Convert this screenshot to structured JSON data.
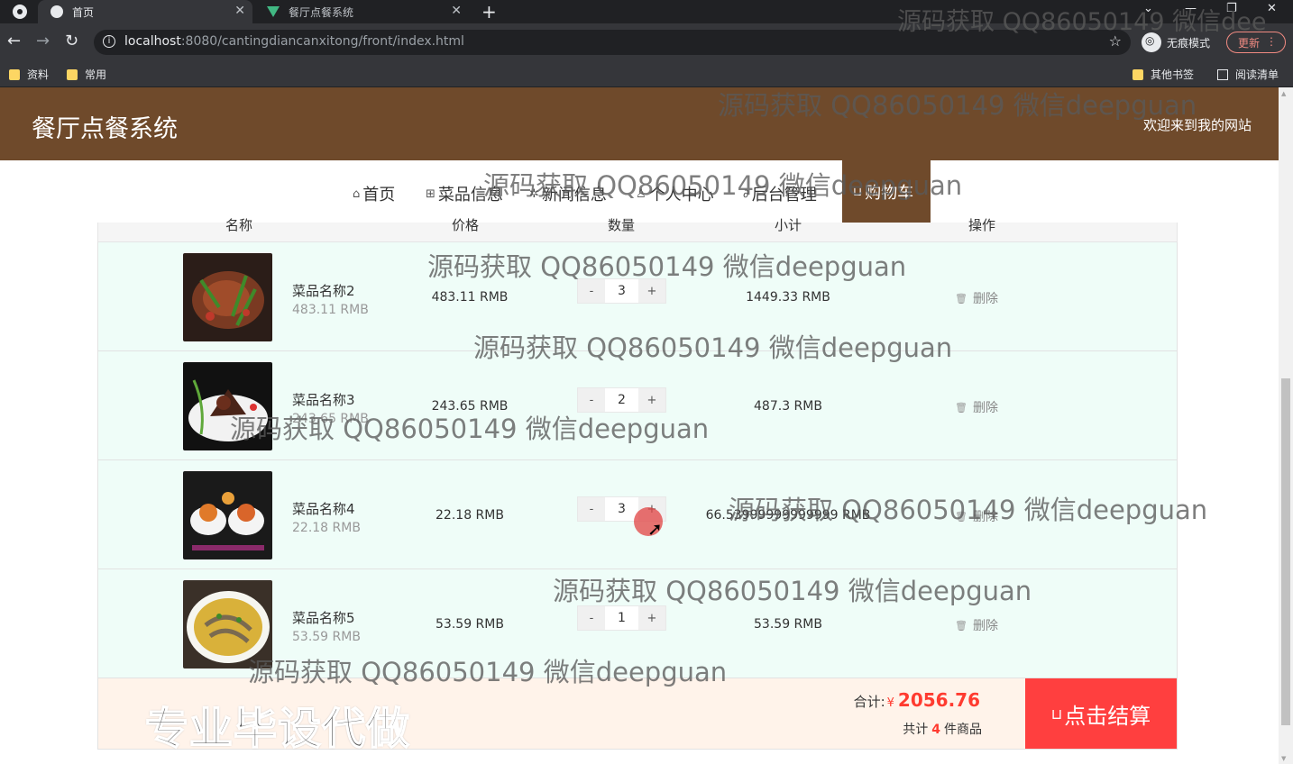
{
  "browser": {
    "tabs": [
      {
        "title": "首页",
        "active": true
      },
      {
        "title": "餐厅点餐系统",
        "active": false
      }
    ],
    "url_host": "localhost",
    "url_rest": ":8080/cantingdiancanxitong/front/index.html",
    "incognito_label": "无痕模式",
    "update_label": "更新",
    "bookmarks": [
      "资料",
      "常用"
    ],
    "bookmarks_right": [
      "其他书签",
      "阅读清单"
    ]
  },
  "site": {
    "title": "餐厅点餐系统",
    "welcome": "欢迎来到我的网站"
  },
  "nav": [
    {
      "label": "首页",
      "icon": "home-icon",
      "glyph": "⌂"
    },
    {
      "label": "菜品信息",
      "icon": "gift-icon",
      "glyph": "⊞"
    },
    {
      "label": "新闻信息",
      "icon": "gear-icon",
      "glyph": "✲"
    },
    {
      "label": "个人中心",
      "icon": "user-icon",
      "glyph": "♙"
    },
    {
      "label": "后台管理",
      "icon": "link-icon",
      "glyph": "∂"
    },
    {
      "label": "购物车",
      "icon": "cart-icon",
      "glyph": "⊔",
      "active": true
    }
  ],
  "cart": {
    "headers": [
      "名称",
      "价格",
      "数量",
      "小计",
      "操作"
    ],
    "items": [
      {
        "name": "菜品名称2",
        "price_sub": "483.11 RMB",
        "price": "483.11 RMB",
        "qty": "3",
        "subtotal": "1449.33 RMB",
        "delete": "删除",
        "img_color": "#6b2a1a"
      },
      {
        "name": "菜品名称3",
        "price_sub": "243.65 RMB",
        "price": "243.65 RMB",
        "qty": "2",
        "subtotal": "487.3 RMB",
        "delete": "删除",
        "img_color": "#3a1f16"
      },
      {
        "name": "菜品名称4",
        "price_sub": "22.18 RMB",
        "price": "22.18 RMB",
        "qty": "3",
        "subtotal": "66.53999999999999 RMB",
        "delete": "删除",
        "img_color": "#d86a2a"
      },
      {
        "name": "菜品名称5",
        "price_sub": "53.59 RMB",
        "price": "53.59 RMB",
        "qty": "1",
        "subtotal": "53.59 RMB",
        "delete": "删除",
        "img_color": "#c8a44a"
      }
    ],
    "minus": "-",
    "plus": "+",
    "total_label": "合计:",
    "currency": "¥",
    "total": "2056.76",
    "count_prefix": "共计",
    "count": "4",
    "count_suffix": "件商品",
    "checkout": "点击结算"
  },
  "promo": "专业毕设代做",
  "watermark": "源码获取 QQ86050149 微信deepguan",
  "watermark_top": "源码获取 QQ86050149 微信dee"
}
